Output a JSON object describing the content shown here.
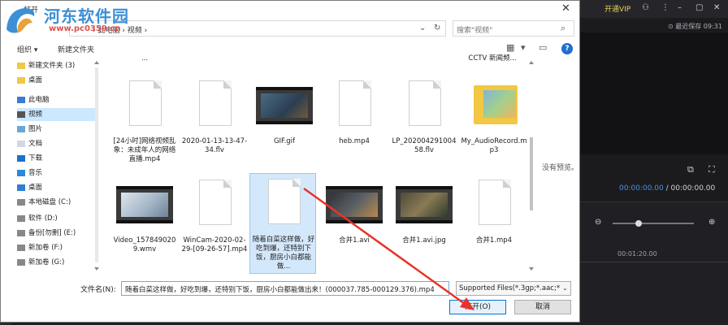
{
  "dialog": {
    "title": "打开",
    "close_label": "✕",
    "watermark": {
      "title": "河东软件园",
      "url": "www.pc0359.cn"
    },
    "address": {
      "path": "› 此电脑 › 视频 ›",
      "refresh": "↻",
      "dropdown": "⌄"
    },
    "search": {
      "placeholder": "搜索\"视频\"",
      "icon": "search-icon"
    },
    "toolbar": {
      "organize": "组织 ▾",
      "new_folder": "新建文件夹",
      "help": "?"
    },
    "nav": [
      {
        "label": "新建文件夹 (3)",
        "icon": "folder"
      },
      {
        "label": "桌面",
        "icon": "folder"
      },
      {
        "label": "此电脑",
        "icon": "pc"
      },
      {
        "label": "视频",
        "icon": "video",
        "selected": true
      },
      {
        "label": "图片",
        "icon": "pictures"
      },
      {
        "label": "文档",
        "icon": "documents"
      },
      {
        "label": "下载",
        "icon": "download"
      },
      {
        "label": "音乐",
        "icon": "music"
      },
      {
        "label": "桌面",
        "icon": "desktop"
      },
      {
        "label": "本地磁盘 (C:)",
        "icon": "drive"
      },
      {
        "label": "软件 (D:)",
        "icon": "drive"
      },
      {
        "label": "备份[勿删] (E:)",
        "icon": "drive"
      },
      {
        "label": "新加卷 (F:)",
        "icon": "drive"
      },
      {
        "label": "新加卷 (G:)",
        "icon": "drive"
      }
    ],
    "top_partial_labels": [
      "...",
      "CCTV 新闻频..."
    ],
    "files": [
      {
        "name": "[24小时]网络视频乱象：未成年人的网络直播.mp4",
        "kind": "doc"
      },
      {
        "name": "2020-01-13-13-47-34.flv",
        "kind": "doc"
      },
      {
        "name": "GIF.gif",
        "kind": "video"
      },
      {
        "name": "heb.mp4",
        "kind": "doc"
      },
      {
        "name": "LP_20200429100458.flv",
        "kind": "doc"
      },
      {
        "name": "My_AudioRecord.mp3",
        "kind": "folder"
      },
      {
        "name": "Video_1578490209.wmv",
        "kind": "video"
      },
      {
        "name": "WinCam-2020-02-29-[09-26-57].mp4",
        "kind": "doc"
      },
      {
        "name": "随着白菜这样做，好吃到爆，还特别下饭，厨房小白都能做...",
        "kind": "doc",
        "selected": true
      },
      {
        "name": "合并1.avi",
        "kind": "video"
      },
      {
        "name": "合并1.avi.jpg",
        "kind": "video"
      },
      {
        "name": "合并1.mp4",
        "kind": "doc"
      }
    ],
    "preview_text": "没有预览。",
    "filename_label": "文件名(N):",
    "filename_value": "随着白菜这样做，好吃到爆，还特别下饭，厨房小白都能做出来！(000037.785-000129.376).mp4",
    "filter_value": "Supported Files(*.3gp;*.aac;*",
    "open_label": "打开(O)",
    "cancel_label": "取消"
  },
  "app": {
    "vip_label": "开通VIP",
    "save_status": "⊙ 最近保存 09:31",
    "time_current": "00:00:00.00",
    "time_sep": " / ",
    "time_total": "00:00:00.00",
    "ruler_mark": "00:01:20.00",
    "zoom_level": 0.3
  },
  "colors": {
    "accent": "#0078d7",
    "annotation_arrow": "#e8332a",
    "watermark_blue": "#3d8fd6"
  }
}
